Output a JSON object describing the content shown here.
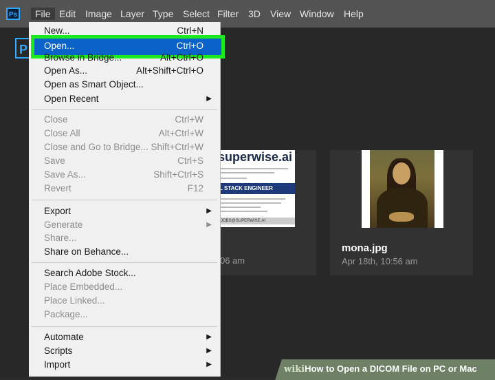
{
  "app": {
    "logo_text": "Ps",
    "home_logo": "P"
  },
  "menubar": {
    "items": [
      "File",
      "Edit",
      "Image",
      "Layer",
      "Type",
      "Select",
      "Filter",
      "3D",
      "View",
      "Window",
      "Help"
    ]
  },
  "file_menu": {
    "new": {
      "label": "New...",
      "shortcut": "Ctrl+N"
    },
    "open": {
      "label": "Open...",
      "shortcut": "Ctrl+O"
    },
    "browse": {
      "label": "Browse in Bridge...",
      "shortcut": "Alt+Ctrl+O"
    },
    "open_as": {
      "label": "Open As...",
      "shortcut": "Alt+Shift+Ctrl+O"
    },
    "open_smart": {
      "label": "Open as Smart Object..."
    },
    "open_recent": {
      "label": "Open Recent"
    },
    "close": {
      "label": "Close",
      "shortcut": "Ctrl+W"
    },
    "close_all": {
      "label": "Close All",
      "shortcut": "Alt+Ctrl+W"
    },
    "close_bridge": {
      "label": "Close and Go to Bridge...",
      "shortcut": "Shift+Ctrl+W"
    },
    "save": {
      "label": "Save",
      "shortcut": "Ctrl+S"
    },
    "save_as": {
      "label": "Save As...",
      "shortcut": "Shift+Ctrl+S"
    },
    "revert": {
      "label": "Revert",
      "shortcut": "F12"
    },
    "export": {
      "label": "Export"
    },
    "generate": {
      "label": "Generate"
    },
    "share": {
      "label": "Share..."
    },
    "share_behance": {
      "label": "Share on Behance..."
    },
    "search_stock": {
      "label": "Search Adobe Stock..."
    },
    "place_embedded": {
      "label": "Place Embedded..."
    },
    "place_linked": {
      "label": "Place Linked..."
    },
    "package": {
      "label": "Package..."
    },
    "automate": {
      "label": "Automate"
    },
    "scripts": {
      "label": "Scripts"
    },
    "import": {
      "label": "Import"
    }
  },
  "recent": {
    "card1": {
      "date_fragment": "06 am",
      "poster": {
        "brand": "superwise.ai",
        "banner": "L STACK ENGINEER",
        "footer": "JOBS@SUPERWISE.AI"
      }
    },
    "card2": {
      "title": "mona.jpg",
      "date": "Apr 18th, 10:56 am"
    }
  },
  "watermark": {
    "wiki": "wiki",
    "text": "How to Open a DICOM File on PC or Mac"
  }
}
